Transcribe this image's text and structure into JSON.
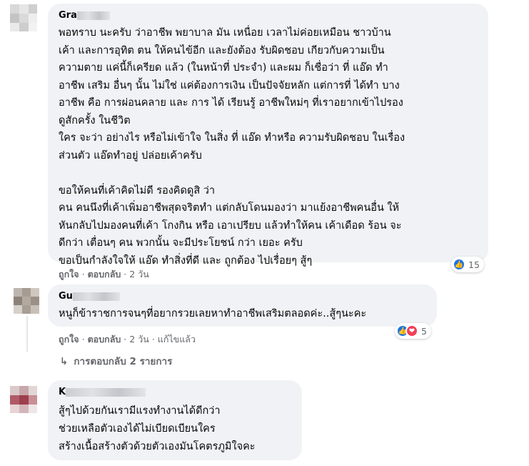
{
  "comments": [
    {
      "author_visible": "Gra",
      "text": "พอทราบ นะครับ ว่าอาชีพ พยาบาล มัน เหนื่อย เวลาไม่ค่อยเหมือน ชาวบ้าน\nเค้า และการอุทิต ตน ให้คนไข้อีก และยังต้อง รับผิดชอบ เกียวกับความเป็น\nความตาย แค่นี้ก็เครียด แล้ว (ในหน้าที่ ประจำ) และผม ก็เชื่อว่า ที่ แอ๊ด ทำ\nอาชีพ เสริม อื่นๆ นั้น ไม่ใช่ แค่ต้องการเงิน เป็นปัจจัยหลัก แต่การที่ ได้ทำ บาง\nอาชีพ คือ การผ่อนคลาย และ การ ได้ เรียนรู้ อาชีพใหม่ๆ ที่เราอยากเข้าไปรอง\nดูสักครั้ง ในชีวิต\nใคร จะว่า อย่างไร หรือไม่เข้าใจ ในสิ่ง ที่ แอ๊ด ทำหรือ ความรับผิดชอบ ในเรื่อง\nส่วนตัว แอ๊ดทำอยู่ ปล่อยเค้าครับ\n\nขอให้คนที่เค้าคิดไม่ดี รองคิดดูสิ ว่า\nคน คนนึงที่เค้าเพิ่มอาชีพสุดจริตทำ แต่กลับโดนมองว่า มาแย้งอาชีพคนอื่น ให้\nหันกลับไปมองคนที่เค้า โกงกิน หรือ เอาเปรียบ แล้วทำให้คน เค้าเดือด ร้อน จะ\nดีกว่า เตื่อนๆ คน พวกนั้น จะมีประโยชน์ กว่า เยอะ ครับ\nขอเป็นกำลังใจให้ แอ๊ด ทำสิ่งที่ดี และ ถูกต้อง ไปเรื่อยๆ สู้ๆ",
      "like_label": "ถูกใจ",
      "reply_label": "ตอบกลับ",
      "time": "2 วัน",
      "reaction_count": "15"
    },
    {
      "author_visible": "Gu",
      "text": "หนูก็ข้าราชการจนๆที่อยากรวยเลยหาทำอาชีพเสริมตลอดค่ะ..สู้ๆนะคะ",
      "like_label": "ถูกใจ",
      "reply_label": "ตอบกลับ",
      "time": "2 วัน",
      "edited_label": "แก้ไขแล้ว",
      "reaction_count": "5"
    },
    {
      "author_visible": "K",
      "text": "สู้ๆไปด้วยกันเรามีแรงทำงานได้ดีกว่า\nช่วยเหลือตัวเองได้ไม่เบียดเบียนใคร\nสร้างเนื้อสร้างตัวด้วยตัวเองมันโคตรภูมิใจคะ"
    }
  ],
  "view_replies_label": "การตอบกลับ 2 รายการ",
  "colors": {
    "bubble": "#f0f2f5",
    "secondary_text": "#65676b",
    "like_blue": "#1b74e4",
    "love_red": "#f33e58"
  },
  "icons": [
    "like-icon",
    "love-icon",
    "reply-arrow-icon"
  ]
}
